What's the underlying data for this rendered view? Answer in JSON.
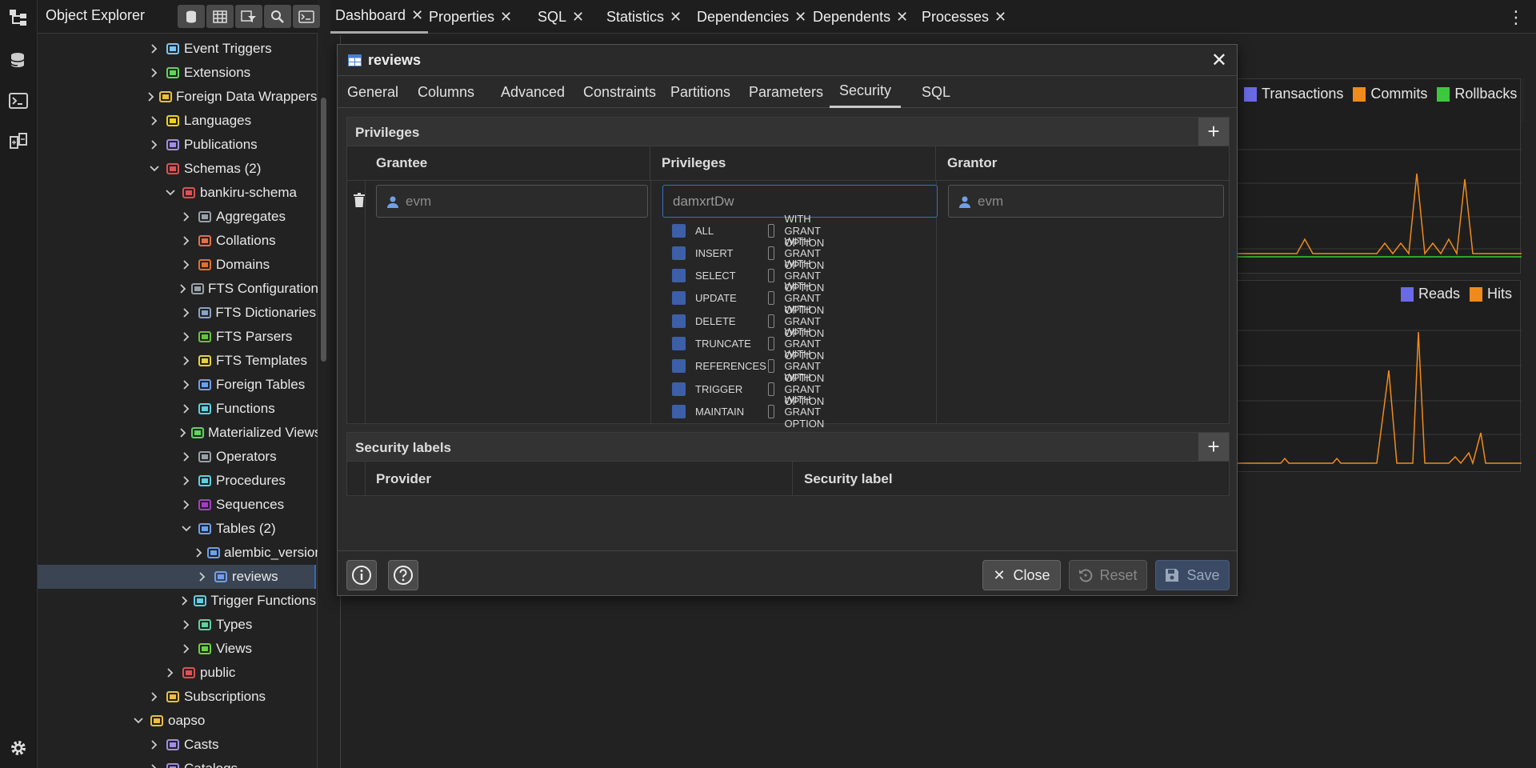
{
  "object_explorer": {
    "title": "Object Explorer",
    "tree": [
      {
        "label": "Event Triggers",
        "icon": "event-trigger-icon",
        "level": 1,
        "expanded": false
      },
      {
        "label": "Extensions",
        "icon": "extension-icon",
        "level": 1,
        "expanded": false
      },
      {
        "label": "Foreign Data Wrappers",
        "icon": "foreign-data-wrapper-icon",
        "level": 1,
        "expanded": false
      },
      {
        "label": "Languages",
        "icon": "language-icon",
        "level": 1,
        "expanded": false
      },
      {
        "label": "Publications",
        "icon": "publication-icon",
        "level": 1,
        "expanded": false
      },
      {
        "label": "Schemas (2)",
        "icon": "schemas-icon",
        "level": 1,
        "expanded": true
      },
      {
        "label": "bankiru-schema",
        "icon": "schema-icon",
        "level": 2,
        "expanded": true
      },
      {
        "label": "Aggregates",
        "icon": "aggregate-icon",
        "level": 3,
        "expanded": false
      },
      {
        "label": "Collations",
        "icon": "collation-icon",
        "level": 3,
        "expanded": false
      },
      {
        "label": "Domains",
        "icon": "domain-icon",
        "level": 3,
        "expanded": false
      },
      {
        "label": "FTS Configurations",
        "icon": "fts-configuration-icon",
        "level": 3,
        "expanded": false
      },
      {
        "label": "FTS Dictionaries",
        "icon": "fts-dictionary-icon",
        "level": 3,
        "expanded": false
      },
      {
        "label": "FTS Parsers",
        "icon": "fts-parser-icon",
        "level": 3,
        "expanded": false
      },
      {
        "label": "FTS Templates",
        "icon": "fts-template-icon",
        "level": 3,
        "expanded": false
      },
      {
        "label": "Foreign Tables",
        "icon": "foreign-table-icon",
        "level": 3,
        "expanded": false
      },
      {
        "label": "Functions",
        "icon": "function-icon",
        "level": 3,
        "expanded": false
      },
      {
        "label": "Materialized Views",
        "icon": "materialized-view-icon",
        "level": 3,
        "expanded": false
      },
      {
        "label": "Operators",
        "icon": "operator-icon",
        "level": 3,
        "expanded": false
      },
      {
        "label": "Procedures",
        "icon": "procedure-icon",
        "level": 3,
        "expanded": false
      },
      {
        "label": "Sequences",
        "icon": "sequence-icon",
        "level": 3,
        "expanded": false
      },
      {
        "label": "Tables (2)",
        "icon": "tables-icon",
        "level": 3,
        "expanded": true
      },
      {
        "label": "alembic_version",
        "icon": "table-icon",
        "level": 4,
        "expanded": false
      },
      {
        "label": "reviews",
        "icon": "table-icon",
        "level": 4,
        "expanded": false,
        "selected": true
      },
      {
        "label": "Trigger Functions",
        "icon": "trigger-function-icon",
        "level": 3,
        "expanded": false
      },
      {
        "label": "Types",
        "icon": "type-icon",
        "level": 3,
        "expanded": false
      },
      {
        "label": "Views",
        "icon": "view-icon",
        "level": 3,
        "expanded": false
      },
      {
        "label": "public",
        "icon": "schema-icon",
        "level": 2,
        "expanded": false
      },
      {
        "label": "Subscriptions",
        "icon": "subscription-icon",
        "level": 1,
        "expanded": false
      },
      {
        "label": "oapso",
        "icon": "database-icon",
        "level": 0,
        "expanded": true
      },
      {
        "label": "Casts",
        "icon": "cast-icon",
        "level": 1,
        "expanded": false
      },
      {
        "label": "Catalogs",
        "icon": "catalog-icon",
        "level": 1,
        "expanded": false
      }
    ]
  },
  "tabs": [
    {
      "label": "Dashboard",
      "active": true
    },
    {
      "label": "Properties"
    },
    {
      "label": "SQL"
    },
    {
      "label": "Statistics"
    },
    {
      "label": "Dependencies"
    },
    {
      "label": "Dependents"
    },
    {
      "label": "Processes"
    }
  ],
  "dashboard": {
    "legend1": [
      "Transactions",
      "Commits",
      "Rollbacks"
    ],
    "legend2": [
      "Reads",
      "Hits"
    ],
    "colors": {
      "blue": "#6a6ae8",
      "orange": "#f08a1a",
      "green": "#3cc83c"
    }
  },
  "dialog": {
    "title": "reviews",
    "tabs": [
      "General",
      "Columns",
      "Advanced",
      "Constraints",
      "Partitions",
      "Parameters",
      "Security",
      "SQL"
    ],
    "active_tab": "Security",
    "privileges_section": {
      "title": "Privileges",
      "columns": [
        "Grantee",
        "Privileges",
        "Grantor"
      ],
      "grantee": "evm",
      "privileges_value": "damxrtDw",
      "grantor": "evm",
      "with_grant_label": "WITH GRANT OPTION",
      "items": [
        "ALL",
        "INSERT",
        "SELECT",
        "UPDATE",
        "DELETE",
        "TRUNCATE",
        "REFERENCES",
        "TRIGGER",
        "MAINTAIN"
      ]
    },
    "security_labels_section": {
      "title": "Security labels",
      "columns": [
        "Provider",
        "Security label"
      ]
    },
    "buttons": {
      "close": "Close",
      "reset": "Reset",
      "save": "Save"
    }
  }
}
